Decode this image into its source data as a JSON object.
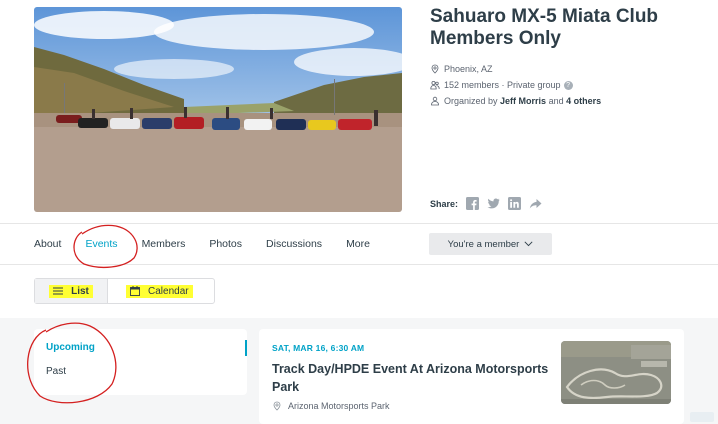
{
  "group": {
    "name": "Sahuaro MX-5 Miata Club Members Only",
    "location": "Phoenix, AZ",
    "members": "152 members · Private group",
    "organized_prefix": "Organized by",
    "organizer": "Jeff Morris",
    "organized_join": "and",
    "others": "4 others"
  },
  "share": {
    "label": "Share:"
  },
  "nav": {
    "tabs": [
      "About",
      "Events",
      "Members",
      "Photos",
      "Discussions",
      "More"
    ],
    "active": "Events",
    "member_button": "You're a member"
  },
  "view_toggle": {
    "list": "List",
    "calendar": "Calendar"
  },
  "filters": {
    "upcoming": "Upcoming",
    "past": "Past"
  },
  "event": {
    "date": "SAT, MAR 16, 6:30 AM",
    "title": "Track Day/HPDE Event At Arizona Motorsports Park",
    "venue": "Arizona Motorsports Park"
  },
  "colors": {
    "accent": "#00a2c7",
    "text": "#2e3e48",
    "highlight": "#ffff33",
    "annotation": "#d42020"
  }
}
